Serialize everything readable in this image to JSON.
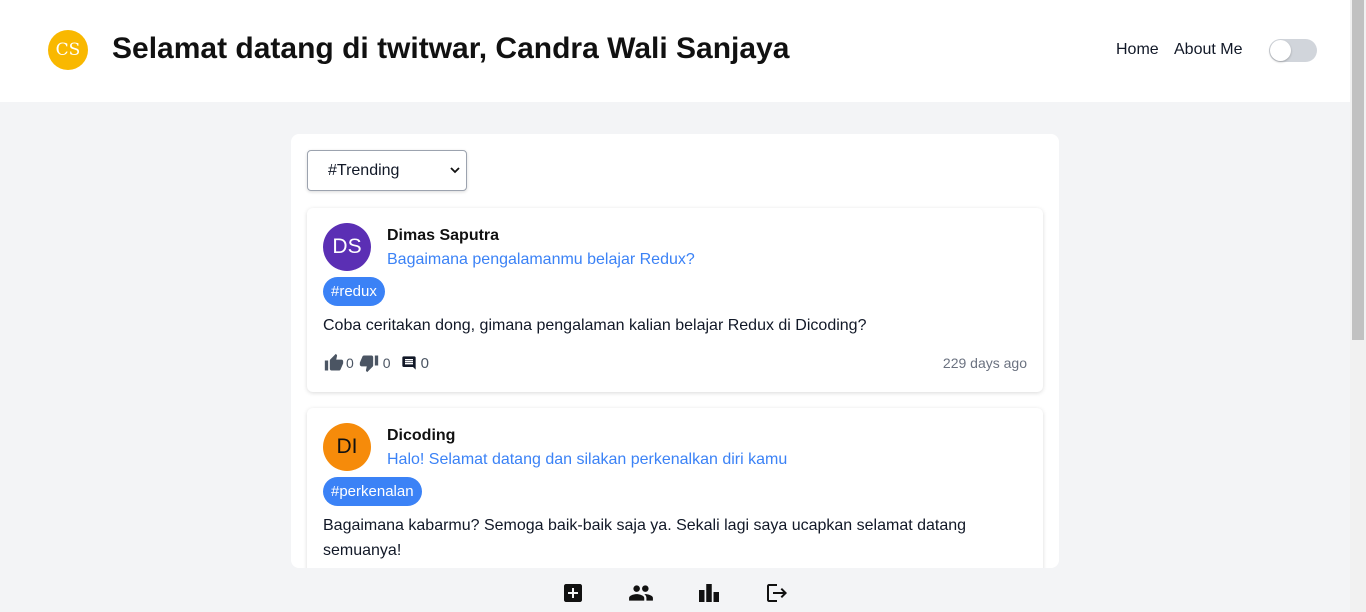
{
  "header": {
    "avatar_initials": "CS",
    "title": "Selamat datang di twitwar, Candra Wali Sanjaya",
    "nav": [
      {
        "label": "Home"
      },
      {
        "label": "About Me"
      }
    ],
    "theme_toggle": {
      "on": false
    }
  },
  "filter": {
    "selected": "#Trending"
  },
  "threads": [
    {
      "avatar_initials": "DS",
      "avatar_color": "#5b2fb4",
      "author": "Dimas Saputra",
      "title": "Bagaimana pengalamanmu belajar Redux?",
      "tag": "#redux",
      "body": "Coba ceritakan dong, gimana pengalaman kalian belajar Redux di Dicoding?",
      "upvotes": "0",
      "downvotes": "0",
      "comments": "0",
      "time": "229 days ago"
    },
    {
      "avatar_initials": "DI",
      "avatar_color": "#f68b0a",
      "author": "Dicoding",
      "title": "Halo! Selamat datang dan silakan perkenalkan diri kamu",
      "tag": "#perkenalan",
      "body": "Bagaimana kabarmu? Semoga baik-baik saja ya. Sekali lagi saya ucapkan selamat datang semuanya!"
    }
  ],
  "bottom_nav": [
    "add-thread-icon",
    "users-icon",
    "leaderboard-icon",
    "logout-icon"
  ],
  "colors": {
    "accent": "#3b82f6",
    "header_avatar": "#f9b800",
    "background": "#f3f4f6"
  }
}
